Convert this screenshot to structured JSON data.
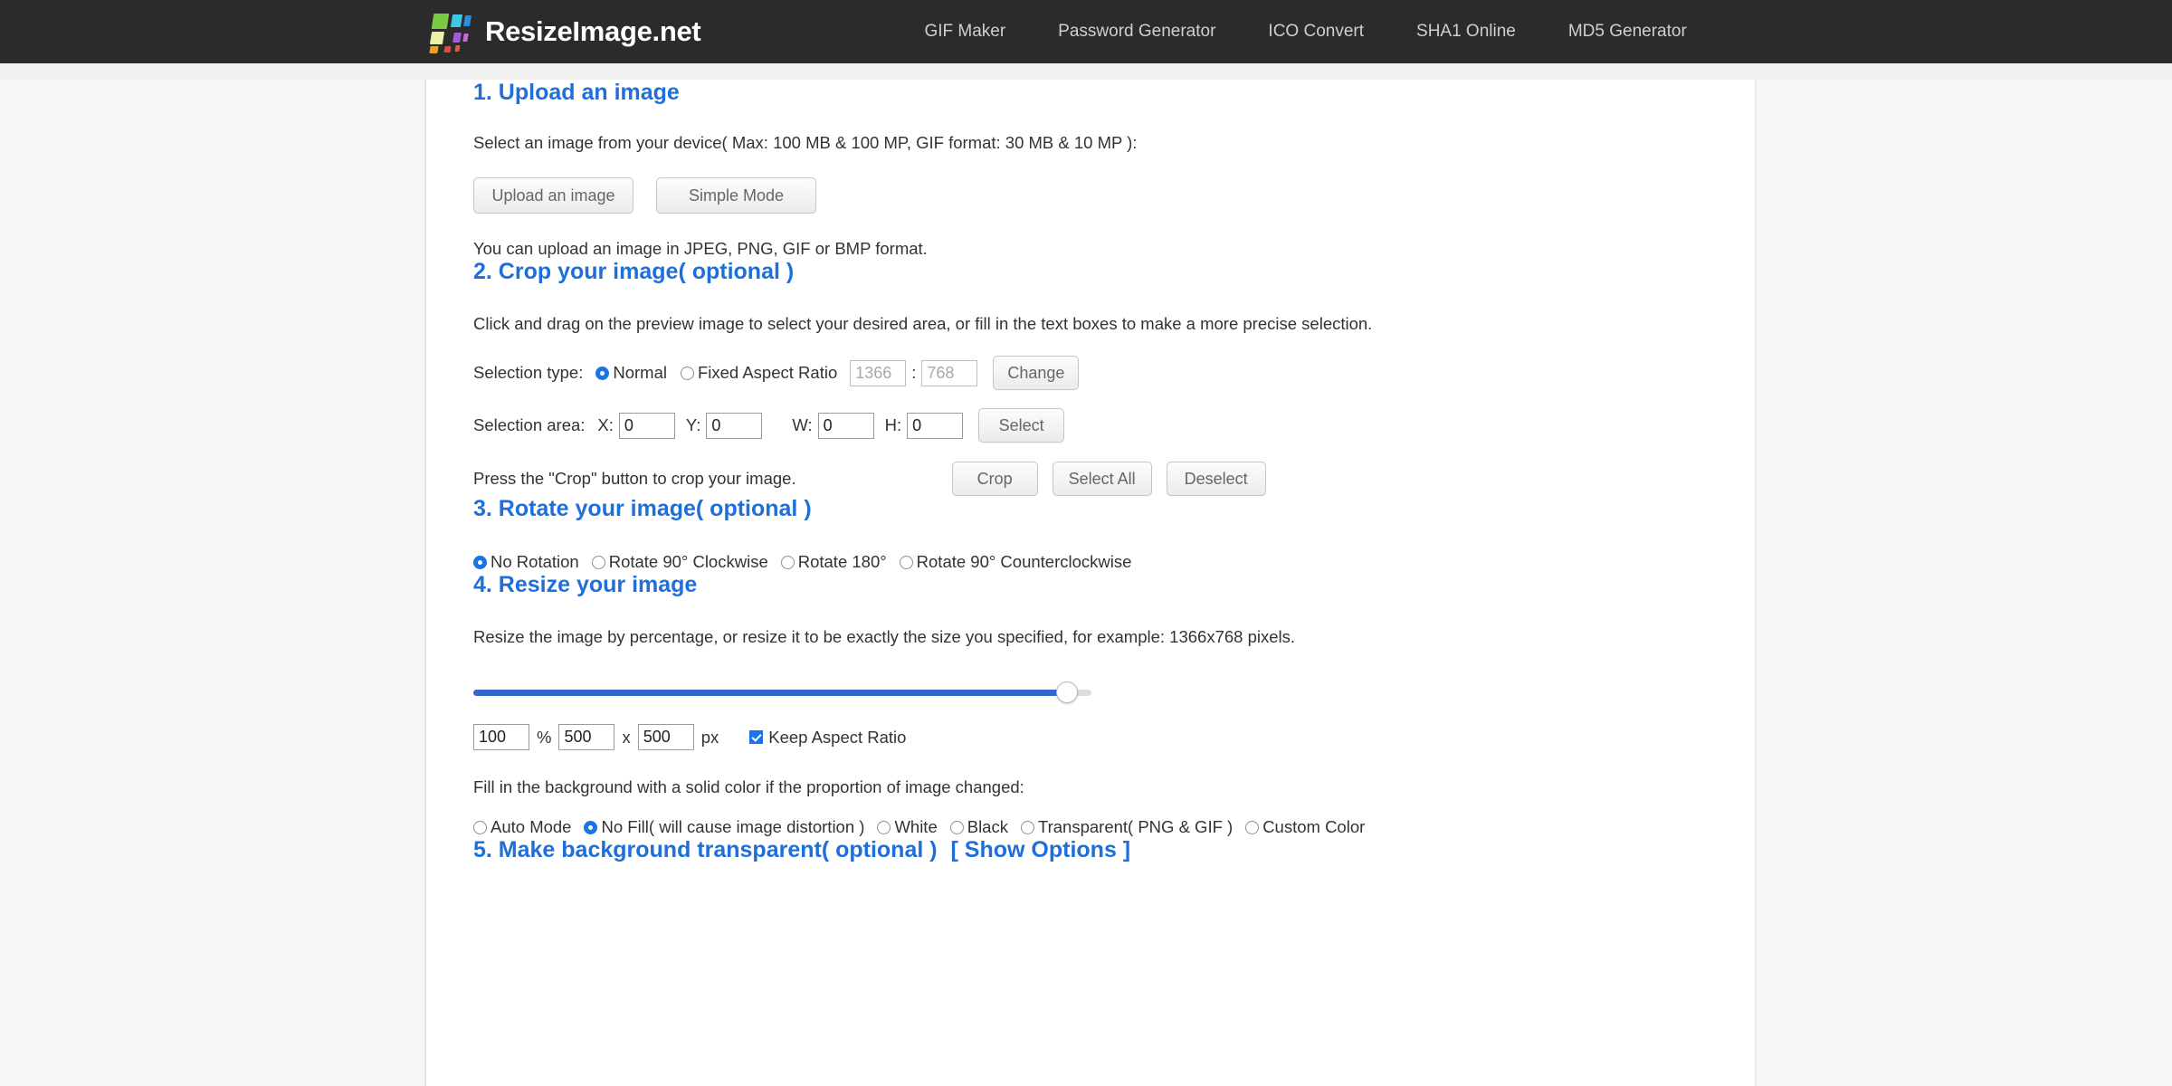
{
  "header": {
    "brand_name": "ResizeImage.net",
    "logo_colors": [
      "#7ac943",
      "#3fc7e8",
      "#2b8fe0",
      "#e8e87a",
      "#a05fd8",
      "#f07c1e",
      "#e8453c"
    ],
    "nav": [
      {
        "label": "GIF Maker"
      },
      {
        "label": "Password Generator"
      },
      {
        "label": "ICO Convert"
      },
      {
        "label": "SHA1 Online"
      },
      {
        "label": "MD5 Generator"
      }
    ]
  },
  "accent_color": "#1e6fd9",
  "section1": {
    "title": "1. Upload an image",
    "description": "Select an image from your device( Max: 100 MB & 100 MP, GIF format: 30 MB & 10 MP ):",
    "upload_button": "Upload an image",
    "simple_mode_button": "Simple Mode",
    "note": "You can upload an image in JPEG, PNG, GIF or BMP format."
  },
  "section2": {
    "title": "2. Crop your image( optional )",
    "description": "Click and drag on the preview image to select your desired area, or fill in the text boxes to make a more precise selection.",
    "selection_type_label": "Selection type:",
    "normal_label": "Normal",
    "normal_selected": true,
    "fixed_ratio_label": "Fixed Aspect Ratio",
    "fixed_ratio_selected": false,
    "ratio_width": "1366",
    "ratio_height": "768",
    "ratio_separator": ":",
    "change_button": "Change",
    "selection_area_label": "Selection area:",
    "x_label": "X:",
    "x_value": "0",
    "y_label": "Y:",
    "y_value": "0",
    "w_label": "W:",
    "w_value": "0",
    "h_label": "H:",
    "h_value": "0",
    "select_button": "Select",
    "crop_hint": "Press the \"Crop\" button to crop your image.",
    "crop_button": "Crop",
    "select_all_button": "Select All",
    "deselect_button": "Deselect"
  },
  "section3": {
    "title": "3. Rotate your image( optional )",
    "options": [
      {
        "label": "No Rotation",
        "selected": true
      },
      {
        "label": "Rotate 90° Clockwise",
        "selected": false
      },
      {
        "label": "Rotate 180°",
        "selected": false
      },
      {
        "label": "Rotate 90° Counterclockwise",
        "selected": false
      }
    ]
  },
  "section4": {
    "title": "4. Resize your image",
    "description": "Resize the image by percentage, or resize it to be exactly the size you specified, for example: 1366x768 pixels.",
    "slider": {
      "value": 100,
      "min": 0,
      "max": 100,
      "fill_percent": 96
    },
    "percent_value": "100",
    "percent_unit": "%",
    "width_value": "500",
    "dimension_separator": "x",
    "height_value": "500",
    "pixel_unit": "px",
    "keep_aspect_ratio_label": "Keep Aspect Ratio",
    "keep_aspect_ratio_checked": true,
    "fill_description": "Fill in the background with a solid color if the proportion of image changed:",
    "fill_options": [
      {
        "label": "Auto Mode",
        "selected": false
      },
      {
        "label": "No Fill( will cause image distortion )",
        "selected": true
      },
      {
        "label": "White",
        "selected": false
      },
      {
        "label": "Black",
        "selected": false
      },
      {
        "label": "Transparent( PNG & GIF )",
        "selected": false
      },
      {
        "label": "Custom Color",
        "selected": false
      }
    ]
  },
  "section5": {
    "title": "5. Make background transparent( optional )",
    "show_options_link": "[ Show Options ]"
  }
}
